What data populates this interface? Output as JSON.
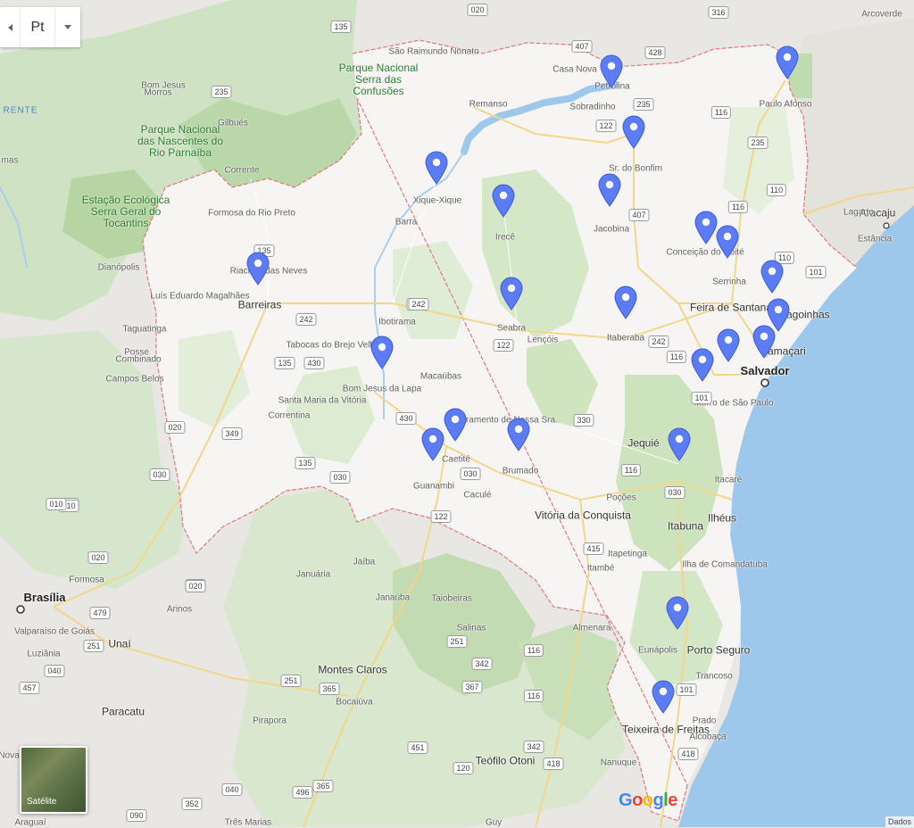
{
  "controls": {
    "lang_label": "Pt",
    "satellite_label": "Satélite",
    "attribution": "Dados"
  },
  "logo_letters": [
    {
      "ch": "G",
      "color": "#4285F4"
    },
    {
      "ch": "o",
      "color": "#EA4335"
    },
    {
      "ch": "o",
      "color": "#FBBC05"
    },
    {
      "ch": "g",
      "color": "#4285F4"
    },
    {
      "ch": "l",
      "color": "#34A853"
    },
    {
      "ch": "e",
      "color": "#EA4335"
    }
  ],
  "colors": {
    "pin": "#5B7CF5",
    "ocean": "#9dc8eb",
    "bahia_land": "#f6f5f3",
    "border": "#e0787c"
  },
  "labels": [
    {
      "text": "Paulo Afonso",
      "cls": "town"
    },
    {
      "text": "Casa Nova",
      "cls": "town"
    },
    {
      "text": "Petrolina",
      "cls": "town"
    },
    {
      "text": "Sobradinho",
      "cls": "town"
    },
    {
      "text": "Remanso",
      "cls": "town"
    },
    {
      "text": "Sr. do Bonfim",
      "cls": "town"
    },
    {
      "text": "Xique-Xique",
      "cls": "town"
    },
    {
      "text": "Barra",
      "cls": "town"
    },
    {
      "text": "Irecê",
      "cls": "town"
    },
    {
      "text": "Jacobina",
      "cls": "town"
    },
    {
      "text": "Conceição do Coité",
      "cls": "town"
    },
    {
      "text": "Serrinha",
      "cls": "town"
    },
    {
      "text": "Feira de Santana",
      "cls": "city"
    },
    {
      "text": "Alagoinhas",
      "cls": "city"
    },
    {
      "text": "Camaçari",
      "cls": "city"
    },
    {
      "text": "Salvador",
      "cls": "big"
    },
    {
      "text": "Morro de São Paulo",
      "cls": "town"
    },
    {
      "text": "Seabra",
      "cls": "town"
    },
    {
      "text": "Lençóis",
      "cls": "town"
    },
    {
      "text": "Itaberaba",
      "cls": "town"
    },
    {
      "text": "Barreiras",
      "cls": "city"
    },
    {
      "text": "Luís Eduardo Magalhães",
      "cls": "town"
    },
    {
      "text": "Riachão das Neves",
      "cls": "town"
    },
    {
      "text": "Formosa do Rio Preto",
      "cls": "town"
    },
    {
      "text": "Ibotirama",
      "cls": "town"
    },
    {
      "text": "Tabocas do Brejo Velho",
      "cls": "town"
    },
    {
      "text": "Bom Jesus da Lapa",
      "cls": "town"
    },
    {
      "text": "Macaúbas",
      "cls": "town"
    },
    {
      "text": "Santa Maria da Vitória",
      "cls": "town"
    },
    {
      "text": "Correntina",
      "cls": "town"
    },
    {
      "text": "Livramento de Nossa Sra.",
      "cls": "town"
    },
    {
      "text": "Caetité",
      "cls": "town"
    },
    {
      "text": "Guanambi",
      "cls": "town"
    },
    {
      "text": "Brumado",
      "cls": "town"
    },
    {
      "text": "Caculé",
      "cls": "town"
    },
    {
      "text": "Jequié",
      "cls": "city"
    },
    {
      "text": "Poções",
      "cls": "town"
    },
    {
      "text": "Vitória da Conquista",
      "cls": "city"
    },
    {
      "text": "Itacaré",
      "cls": "town"
    },
    {
      "text": "Ilhéus",
      "cls": "city"
    },
    {
      "text": "Itabuna",
      "cls": "city"
    },
    {
      "text": "Itapetinga",
      "cls": "town"
    },
    {
      "text": "Itambé",
      "cls": "town"
    },
    {
      "text": "Ilha de Comandatuba",
      "cls": "town"
    },
    {
      "text": "Eunápolis",
      "cls": "town"
    },
    {
      "text": "Porto Seguro",
      "cls": "city"
    },
    {
      "text": "Trancoso",
      "cls": "town"
    },
    {
      "text": "Teixeira de Freitas",
      "cls": "city"
    },
    {
      "text": "Prado",
      "cls": "town"
    },
    {
      "text": "Alcobaça",
      "cls": "town"
    },
    {
      "text": "Nanuque",
      "cls": "town"
    },
    {
      "text": "Teófilo Otoni",
      "cls": "city"
    },
    {
      "text": "Montes Claros",
      "cls": "city"
    },
    {
      "text": "Bocaiúva",
      "cls": "town"
    },
    {
      "text": "Janaúba",
      "cls": "town"
    },
    {
      "text": "Januária",
      "cls": "town"
    },
    {
      "text": "Jaíba",
      "cls": "town"
    },
    {
      "text": "Taiobeiras",
      "cls": "town"
    },
    {
      "text": "Salinas",
      "cls": "town"
    },
    {
      "text": "Almenara",
      "cls": "town"
    },
    {
      "text": "Pirapora",
      "cls": "town"
    },
    {
      "text": "Paracatu",
      "cls": "city"
    },
    {
      "text": "Unaí",
      "cls": "city"
    },
    {
      "text": "Arinos",
      "cls": "town"
    },
    {
      "text": "Formosa",
      "cls": "town"
    },
    {
      "text": "Brasília",
      "cls": "big"
    },
    {
      "text": "Valparaíso de Goiás",
      "cls": "town"
    },
    {
      "text": "Luziânia",
      "cls": "town"
    },
    {
      "text": "Posse",
      "cls": "town"
    },
    {
      "text": "Campos Belos",
      "cls": "town"
    },
    {
      "text": "Combinado",
      "cls": "town"
    },
    {
      "text": "Taguatinga",
      "cls": "town"
    },
    {
      "text": "Dianópolis",
      "cls": "town"
    },
    {
      "text": "Aracaju",
      "cls": "city"
    },
    {
      "text": "Estância",
      "cls": "town"
    },
    {
      "text": "Lagarto",
      "cls": "town"
    },
    {
      "text": "Arcoverde",
      "cls": "town"
    },
    {
      "text": "Bom Jesus",
      "cls": "town"
    },
    {
      "text": "Gilbués",
      "cls": "town"
    },
    {
      "text": "Corrente",
      "cls": "town"
    },
    {
      "text": "Morros",
      "cls": "town"
    },
    {
      "text": "São Raimundo Nonato",
      "cls": "town"
    },
    {
      "text": "Parque Nacional Serra das Confusões",
      "cls": "park"
    },
    {
      "text": "Parque Nacional das Nascentes do Rio Parnaíba",
      "cls": "park"
    },
    {
      "text": "Estação Ecológica Serra Geral do Tocantins",
      "cls": "park"
    },
    {
      "text": "RENTE",
      "cls": "water"
    },
    {
      "text": "mas",
      "cls": "town"
    },
    {
      "text": "Nova",
      "cls": "town"
    },
    {
      "text": "Araguaí",
      "cls": "town"
    },
    {
      "text": "Guy",
      "cls": "town"
    },
    {
      "text": "Três Marias",
      "cls": "town"
    }
  ],
  "shields": [
    "020",
    "135",
    "316",
    "407",
    "428",
    "235",
    "235",
    "116",
    "235",
    "122",
    "110",
    "116",
    "407",
    "110",
    "101",
    "242",
    "242",
    "122",
    "242",
    "116",
    "101",
    "135",
    "430",
    "135",
    "242",
    "430",
    "330",
    "116",
    "030",
    "030",
    "030",
    "349",
    "135",
    "020",
    "010",
    "020",
    "030",
    "122",
    "415",
    "479",
    "479",
    "251",
    "040",
    "457",
    "251",
    "365",
    "342",
    "116",
    "367",
    "251",
    "116",
    "451",
    "120",
    "342",
    "418",
    "418",
    "101",
    "040",
    "496",
    "365",
    "352",
    "090",
    "010",
    "010",
    "020"
  ],
  "markers": [
    "Petrolina",
    "Paulo Afonso",
    "Sr. do Bonfim",
    "Xique-Xique",
    "Irecê",
    "Jacobina",
    "Conceição do Coité",
    "Serrinha",
    "Alagoinhas",
    "Camaçari",
    "Salvador",
    "Feira de Santana",
    "Barreiras",
    "Seabra",
    "Itaberaba",
    "Bom Jesus da Lapa",
    "Morro de São Paulo",
    "Caetité",
    "Guanambi",
    "Brumado",
    "Jequié",
    "Eunápolis",
    "Teixeira de Freitas"
  ]
}
